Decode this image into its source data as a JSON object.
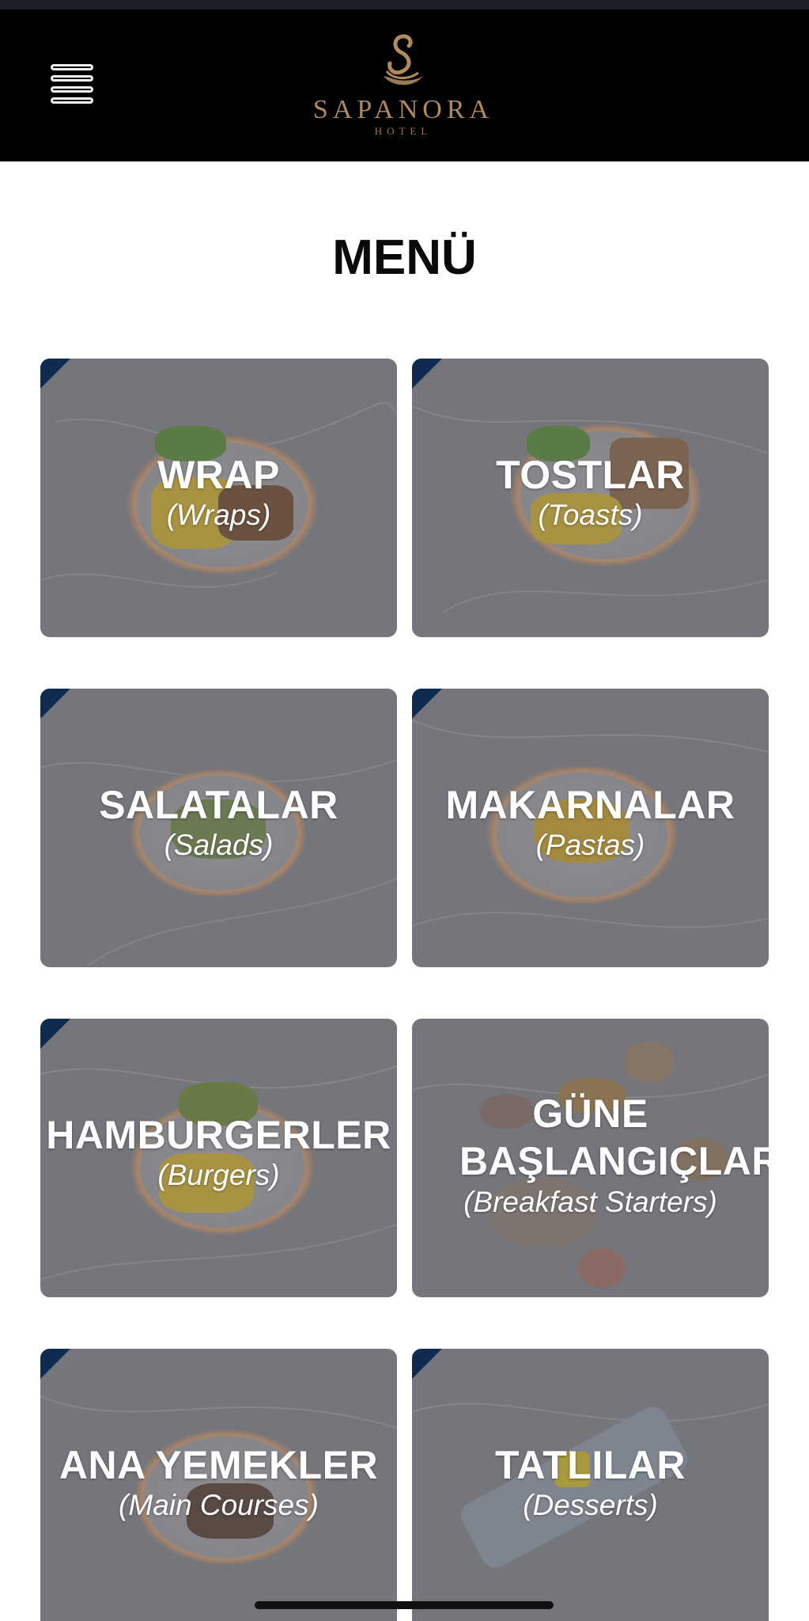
{
  "brand": {
    "name": "SAPANORA",
    "sub": "HOTEL",
    "color": "#b08a5c"
  },
  "header": {
    "menu_icon": "hamburger-menu-icon"
  },
  "title": "MENÜ",
  "categories": [
    {
      "tr": "WRAP",
      "en": "(Wraps)"
    },
    {
      "tr": "TOSTLAR",
      "en": "(Toasts)"
    },
    {
      "tr": "SALATALAR",
      "en": "(Salads)"
    },
    {
      "tr": "MAKARNALAR",
      "en": "(Pastas)"
    },
    {
      "tr": "HAMBURGERLER",
      "en": "(Burgers)"
    },
    {
      "tr": "GÜNE BAŞLANGIÇLAR",
      "en": "(Breakfast Starters)"
    },
    {
      "tr": "ANA YEMEKLER",
      "en": "(Main Courses)"
    },
    {
      "tr": "TATLILAR",
      "en": "(Desserts)"
    }
  ],
  "colors": {
    "header_bg": "#000000",
    "card_overlay": "#75767b",
    "corner_accent": "#0f2b52"
  }
}
